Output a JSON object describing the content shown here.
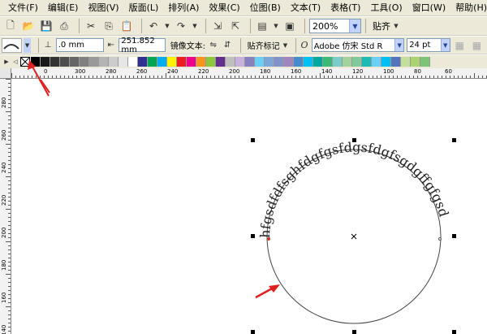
{
  "menu": [
    "文件(F)",
    "编辑(E)",
    "视图(V)",
    "版面(L)",
    "排列(A)",
    "效果(C)",
    "位图(B)",
    "文本(T)",
    "表格(T)",
    "工具(O)",
    "窗口(W)",
    "帮助(H)"
  ],
  "toolbar": {
    "zoom": "200%",
    "snap_label": "贴齐"
  },
  "propbar": {
    "offset_value": ".0 mm",
    "distance_value": "251.852 mm",
    "mirror_label": "镜像文本:",
    "snap_mark_label": "贴齐标记",
    "font_name": "Adobe 仿宋 Std R",
    "font_size": "24 pt"
  },
  "palette_colors": [
    "#000000",
    "#1a1a1a",
    "#333333",
    "#4d4d4d",
    "#666666",
    "#808080",
    "#999999",
    "#b3b3b3",
    "#cccccc",
    "#e6e6e6",
    "#ffffff",
    "#2e3192",
    "#00a651",
    "#00aeef",
    "#fff200",
    "#ed1c24",
    "#ec008c",
    "#f7941d",
    "#8dc63f",
    "#662d91",
    "#bfbfbf",
    "#c7b2de",
    "#8781bd",
    "#6dcff6",
    "#7da7d9",
    "#8393ca",
    "#a186be",
    "#448ccb",
    "#00bff3",
    "#00a99d",
    "#3cb878",
    "#7accc8",
    "#a3d39c",
    "#82ca9c",
    "#1cbbb4",
    "#6ecff6",
    "#00bff3",
    "#5674b9",
    "#c4df9b",
    "#acd373",
    "#7cc576"
  ],
  "ruler_top_labels": [
    "0",
    "300",
    "280",
    "260",
    "240",
    "220",
    "200",
    "180",
    "160",
    "140",
    "120",
    "100",
    "80",
    "60"
  ],
  "ruler_left_labels": [
    "280",
    "260",
    "240",
    "220",
    "200",
    "180",
    "160",
    "140"
  ],
  "canvas": {
    "arc_text": "hfgsdfdfsghfdgfgsfdgsfdgfsgdgffgfgsd"
  }
}
